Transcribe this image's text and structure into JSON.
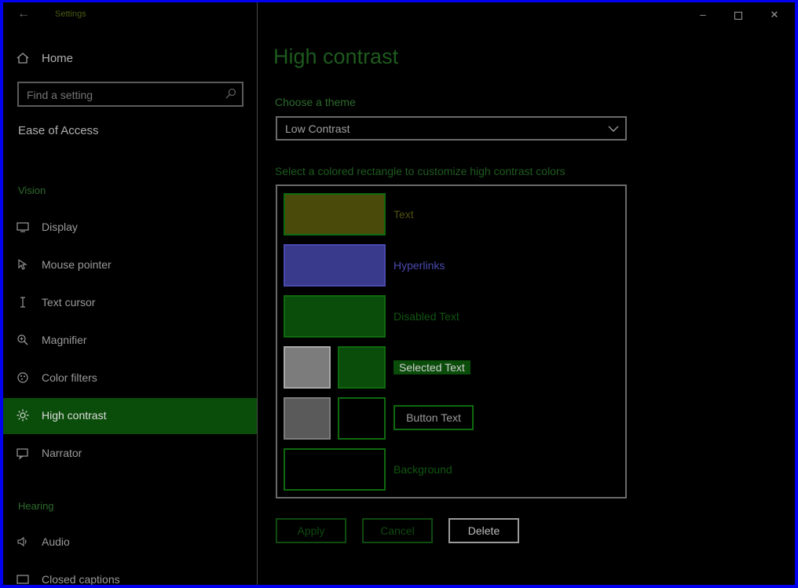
{
  "window": {
    "title": "Settings",
    "minimize_icon": "minimize-icon",
    "maximize_icon": "maximize-icon",
    "close_icon": "close-icon"
  },
  "sidebar": {
    "home_label": "Home",
    "search_placeholder": "Find a setting",
    "category": "Ease of Access",
    "sections": [
      {
        "heading": "Vision",
        "items": [
          {
            "label": "Display",
            "icon": "display-icon"
          },
          {
            "label": "Mouse pointer",
            "icon": "mouse-pointer-icon"
          },
          {
            "label": "Text cursor",
            "icon": "text-cursor-icon"
          },
          {
            "label": "Magnifier",
            "icon": "magnifier-icon"
          },
          {
            "label": "Color filters",
            "icon": "color-filters-icon"
          },
          {
            "label": "High contrast",
            "icon": "high-contrast-icon",
            "active": true
          },
          {
            "label": "Narrator",
            "icon": "narrator-icon"
          }
        ]
      },
      {
        "heading": "Hearing",
        "items": [
          {
            "label": "Audio",
            "icon": "audio-icon"
          },
          {
            "label": "Closed captions",
            "icon": "closed-captions-icon"
          }
        ]
      }
    ]
  },
  "main": {
    "title": "High contrast",
    "theme_label": "Choose a theme",
    "theme_value": "Low Contrast",
    "colors_hint": "Select a colored rectangle to customize high contrast colors",
    "color_rows": [
      {
        "label": "Text",
        "color": "#4a4a0a",
        "label_color": "#4f4f12"
      },
      {
        "label": "Hyperlinks",
        "color": "#3a3a8c",
        "label_color": "#4a4ab0"
      },
      {
        "label": "Disabled Text",
        "color": "#0a4c0a",
        "label_color": "#115511"
      },
      {
        "label": "Selected Text",
        "bg_color": "#7c7c7c",
        "color": "#0a4c0a",
        "label_color": "#cfcfcf",
        "label_bg": "#0a4c0a"
      },
      {
        "label": "Button Text",
        "bg_color": "#5a5a5a",
        "color": "#000000",
        "label_color": "#9a9a9a"
      },
      {
        "label": "Background",
        "color": "#000000",
        "label_color": "#115511"
      }
    ],
    "buttons": {
      "apply": "Apply",
      "cancel": "Cancel",
      "delete": "Delete"
    }
  },
  "colors": {
    "accent": "#0a4c0a",
    "window_border": "#0000ee",
    "background": "#000000"
  }
}
